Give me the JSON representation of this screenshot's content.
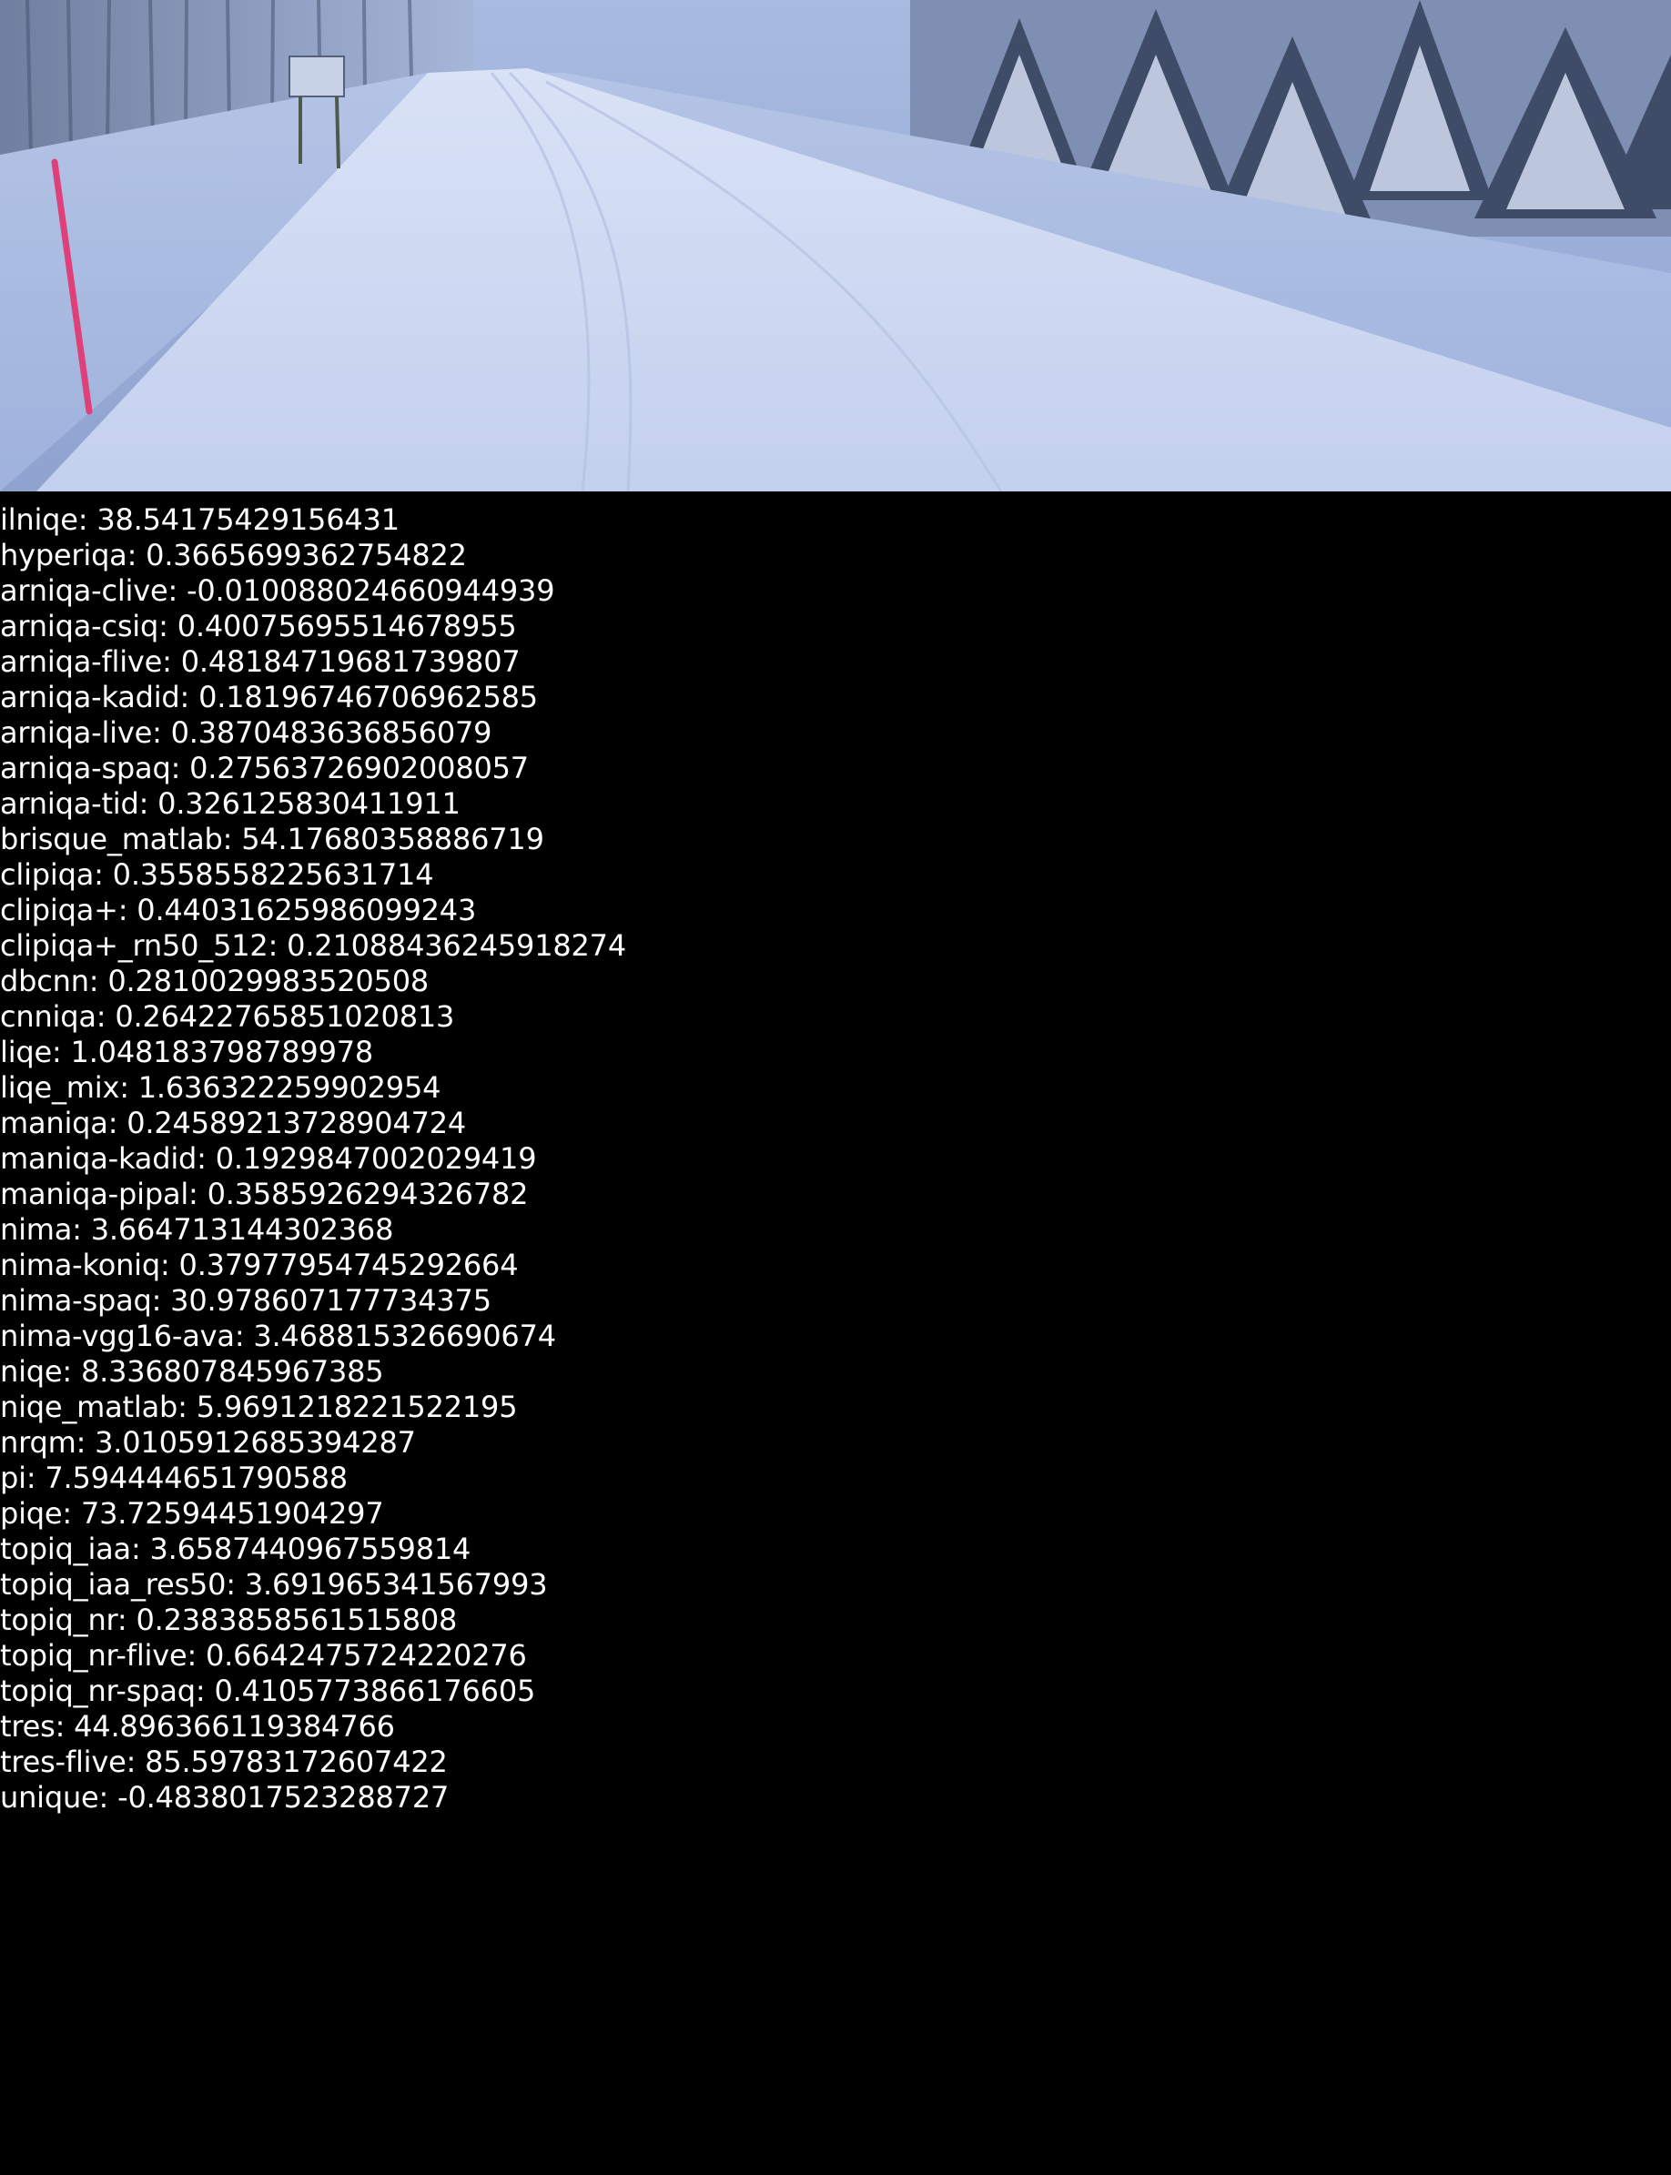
{
  "photo": {
    "icon": "snowy-road-photo",
    "colors": {
      "sky": "#9fb3db",
      "snow": "#c9d6f0",
      "road": "#d6e0f5",
      "trees": "#3c4a63",
      "post": "#e0407a"
    }
  },
  "metrics": [
    {
      "name": "ilniqe",
      "value": "38.54175429156431"
    },
    {
      "name": "hyperiqa",
      "value": "0.3665699362754822"
    },
    {
      "name": "arniqa-clive",
      "value": "-0.010088024660944939"
    },
    {
      "name": "arniqa-csiq",
      "value": "0.40075695514678955"
    },
    {
      "name": "arniqa-flive",
      "value": "0.48184719681739807"
    },
    {
      "name": "arniqa-kadid",
      "value": "0.18196746706962585"
    },
    {
      "name": "arniqa-live",
      "value": "0.3870483636856079"
    },
    {
      "name": "arniqa-spaq",
      "value": "0.27563726902008057"
    },
    {
      "name": "arniqa-tid",
      "value": "0.326125830411911"
    },
    {
      "name": "brisque_matlab",
      "value": "54.17680358886719"
    },
    {
      "name": "clipiqa",
      "value": "0.3558558225631714"
    },
    {
      "name": "clipiqa+",
      "value": "0.44031625986099243"
    },
    {
      "name": "clipiqa+_rn50_512",
      "value": "0.21088436245918274"
    },
    {
      "name": "dbcnn",
      "value": "0.2810029983520508"
    },
    {
      "name": "cnniqa",
      "value": "0.26422765851020813"
    },
    {
      "name": "liqe",
      "value": "1.048183798789978"
    },
    {
      "name": "liqe_mix",
      "value": "1.636322259902954"
    },
    {
      "name": "maniqa",
      "value": "0.24589213728904724"
    },
    {
      "name": "maniqa-kadid",
      "value": "0.1929847002029419"
    },
    {
      "name": "maniqa-pipal",
      "value": "0.3585926294326782"
    },
    {
      "name": "nima",
      "value": "3.664713144302368"
    },
    {
      "name": "nima-koniq",
      "value": "0.37977954745292664"
    },
    {
      "name": "nima-spaq",
      "value": "30.978607177734375"
    },
    {
      "name": "nima-vgg16-ava",
      "value": "3.468815326690674"
    },
    {
      "name": "niqe",
      "value": "8.336807845967385"
    },
    {
      "name": "niqe_matlab",
      "value": "5.9691218221522195"
    },
    {
      "name": "nrqm",
      "value": "3.0105912685394287"
    },
    {
      "name": "pi",
      "value": "7.594444651790588"
    },
    {
      "name": "piqe",
      "value": "73.72594451904297"
    },
    {
      "name": "topiq_iaa",
      "value": "3.6587440967559814"
    },
    {
      "name": "topiq_iaa_res50",
      "value": "3.691965341567993"
    },
    {
      "name": "topiq_nr",
      "value": "0.2383858561515808"
    },
    {
      "name": "topiq_nr-flive",
      "value": "0.6642475724220276"
    },
    {
      "name": "topiq_nr-spaq",
      "value": "0.4105773866176605"
    },
    {
      "name": "tres",
      "value": "44.896366119384766"
    },
    {
      "name": "tres-flive",
      "value": "85.59783172607422"
    },
    {
      "name": "unique",
      "value": "-0.4838017523288727"
    }
  ]
}
